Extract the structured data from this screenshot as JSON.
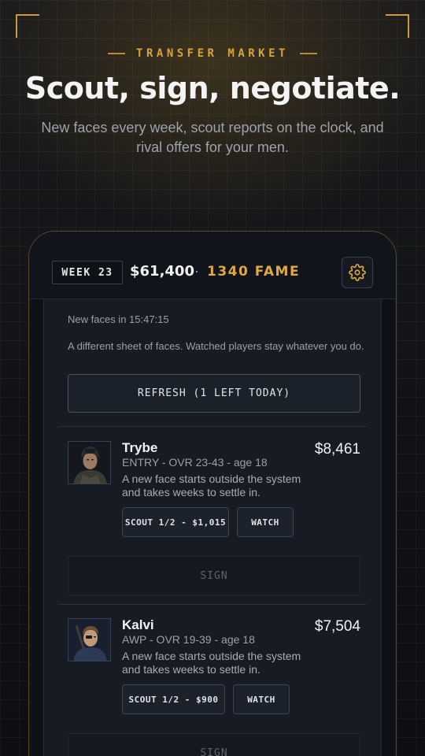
{
  "hero": {
    "kicker": "TRANSFER MARKET",
    "title": "Scout, sign, negotiate.",
    "subtitle": "New faces every week, scout reports on the clock, and rival offers for your men."
  },
  "status_bar": {
    "week": "WEEK 23",
    "money": "$61,400",
    "separator": "·",
    "fame": "1340 FAME",
    "settings_icon": "gear-icon",
    "accent_color": "#e0a93e"
  },
  "market": {
    "timer_text": "New faces in 15:47:15",
    "note": "A different sheet of faces. Watched players stay whatever you do.",
    "refresh_label": "REFRESH (1 LEFT TODAY)"
  },
  "players": [
    {
      "name": "Trybe",
      "meta": "ENTRY - OVR 23-43 - age 18",
      "price": "$8,461",
      "description": "A new face starts outside the system and takes weeks to settle in.",
      "scout_label": "SCOUT 1/2 - $1,015",
      "watch_label": "WATCH",
      "sign_label": "SIGN"
    },
    {
      "name": "Kalvi",
      "meta": "AWP - OVR 19-39 - age 18",
      "price": "$7,504",
      "description": "A new face starts outside the system and takes weeks to settle in.",
      "scout_label": "SCOUT 1/2 - $900",
      "watch_label": "WATCH",
      "sign_label": "SIGN"
    }
  ]
}
